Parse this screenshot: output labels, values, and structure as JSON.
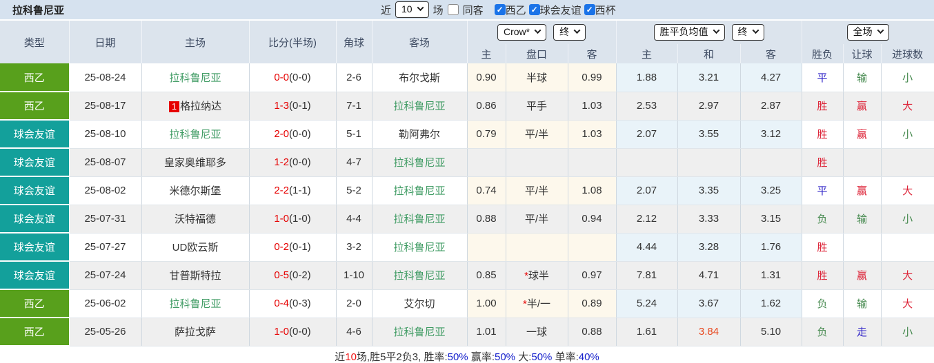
{
  "title": "拉科鲁尼亚",
  "topbar": {
    "near": "近",
    "count": "10",
    "games": "场",
    "same_opponent": "同客",
    "filters": [
      {
        "label": "西乙",
        "checked": true
      },
      {
        "label": "球会友谊",
        "checked": true
      },
      {
        "label": "西杯",
        "checked": true
      }
    ]
  },
  "header": {
    "cols": [
      "类型",
      "日期",
      "主场",
      "比分(半场)",
      "角球",
      "客场"
    ],
    "odds_provider": "Crow*",
    "odds_time": "终",
    "avg_provider": "胜平负均值",
    "avg_time": "终",
    "scope": "全场",
    "odds_cols": [
      "主",
      "盘口",
      "客"
    ],
    "avg_cols": [
      "主",
      "和",
      "客"
    ],
    "result_cols": [
      "胜负",
      "让球",
      "进球数"
    ]
  },
  "colors": {
    "badge_green": "#58a01c",
    "badge_teal": "#13a09b",
    "team_green": "#3f9b63",
    "score_red": "#e60000",
    "result_red": "#dd2438",
    "result_green": "#45894e",
    "result_blue": "#3226c8",
    "avg_orange_red": "#e8481f",
    "summary_blue": "#1722cc",
    "checkbox_blue": "#1a73e8"
  },
  "rows": [
    {
      "type": "西乙",
      "badge": "green",
      "date": "25-08-24",
      "home": {
        "name": "拉科鲁尼亚",
        "green": true,
        "rank": ""
      },
      "score": {
        "full": "0-0",
        "half": "(0-0)"
      },
      "corner": "2-6",
      "away": {
        "name": "布尔戈斯",
        "green": false
      },
      "odds": {
        "home": "0.90",
        "line": "半球",
        "star": false,
        "away": "0.99"
      },
      "avg": {
        "home": "1.88",
        "draw": "3.21",
        "away": "4.27",
        "draw_red": false
      },
      "result": [
        {
          "t": "平",
          "c": "blue"
        },
        {
          "t": "输",
          "c": "green"
        },
        {
          "t": "小",
          "c": "green"
        }
      ]
    },
    {
      "type": "西乙",
      "badge": "green",
      "date": "25-08-17",
      "home": {
        "name": "格拉纳达",
        "green": false,
        "rank": "1"
      },
      "score": {
        "full": "1-3",
        "half": "(0-1)"
      },
      "corner": "7-1",
      "away": {
        "name": "拉科鲁尼亚",
        "green": true
      },
      "odds": {
        "home": "0.86",
        "line": "平手",
        "star": false,
        "away": "1.03"
      },
      "avg": {
        "home": "2.53",
        "draw": "2.97",
        "away": "2.87",
        "draw_red": false
      },
      "result": [
        {
          "t": "胜",
          "c": "red"
        },
        {
          "t": "赢",
          "c": "red"
        },
        {
          "t": "大",
          "c": "red"
        }
      ]
    },
    {
      "type": "球会友谊",
      "badge": "teal",
      "date": "25-08-10",
      "home": {
        "name": "拉科鲁尼亚",
        "green": true,
        "rank": ""
      },
      "score": {
        "full": "2-0",
        "half": "(0-0)"
      },
      "corner": "5-1",
      "away": {
        "name": "勒阿弗尔",
        "green": false
      },
      "odds": {
        "home": "0.79",
        "line": "平/半",
        "star": false,
        "away": "1.03"
      },
      "avg": {
        "home": "2.07",
        "draw": "3.55",
        "away": "3.12",
        "draw_red": false
      },
      "result": [
        {
          "t": "胜",
          "c": "red"
        },
        {
          "t": "赢",
          "c": "red"
        },
        {
          "t": "小",
          "c": "green"
        }
      ]
    },
    {
      "type": "球会友谊",
      "badge": "teal",
      "date": "25-08-07",
      "home": {
        "name": "皇家奥维耶多",
        "green": false,
        "rank": ""
      },
      "score": {
        "full": "1-2",
        "half": "(0-0)"
      },
      "corner": "4-7",
      "away": {
        "name": "拉科鲁尼亚",
        "green": true
      },
      "odds": {
        "home": "",
        "line": "",
        "star": false,
        "away": ""
      },
      "avg": {
        "home": "",
        "draw": "",
        "away": "",
        "draw_red": false
      },
      "result": [
        {
          "t": "胜",
          "c": "red"
        },
        {
          "t": "",
          "c": "dark"
        },
        {
          "t": "",
          "c": "dark"
        }
      ]
    },
    {
      "type": "球会友谊",
      "badge": "teal",
      "date": "25-08-02",
      "home": {
        "name": "米德尔斯堡",
        "green": false,
        "rank": ""
      },
      "score": {
        "full": "2-2",
        "half": "(1-1)"
      },
      "corner": "5-2",
      "away": {
        "name": "拉科鲁尼亚",
        "green": true
      },
      "odds": {
        "home": "0.74",
        "line": "平/半",
        "star": false,
        "away": "1.08"
      },
      "avg": {
        "home": "2.07",
        "draw": "3.35",
        "away": "3.25",
        "draw_red": false
      },
      "result": [
        {
          "t": "平",
          "c": "blue"
        },
        {
          "t": "赢",
          "c": "red"
        },
        {
          "t": "大",
          "c": "red"
        }
      ]
    },
    {
      "type": "球会友谊",
      "badge": "teal",
      "date": "25-07-31",
      "home": {
        "name": "沃特福德",
        "green": false,
        "rank": ""
      },
      "score": {
        "full": "1-0",
        "half": "(1-0)"
      },
      "corner": "4-4",
      "away": {
        "name": "拉科鲁尼亚",
        "green": true
      },
      "odds": {
        "home": "0.88",
        "line": "平/半",
        "star": false,
        "away": "0.94"
      },
      "avg": {
        "home": "2.12",
        "draw": "3.33",
        "away": "3.15",
        "draw_red": false
      },
      "result": [
        {
          "t": "负",
          "c": "green"
        },
        {
          "t": "输",
          "c": "green"
        },
        {
          "t": "小",
          "c": "green"
        }
      ]
    },
    {
      "type": "球会友谊",
      "badge": "teal",
      "date": "25-07-27",
      "home": {
        "name": "UD欧云斯",
        "green": false,
        "rank": ""
      },
      "score": {
        "full": "0-2",
        "half": "(0-1)"
      },
      "corner": "3-2",
      "away": {
        "name": "拉科鲁尼亚",
        "green": true
      },
      "odds": {
        "home": "",
        "line": "",
        "star": false,
        "away": ""
      },
      "avg": {
        "home": "4.44",
        "draw": "3.28",
        "away": "1.76",
        "draw_red": false
      },
      "result": [
        {
          "t": "胜",
          "c": "red"
        },
        {
          "t": "",
          "c": "dark"
        },
        {
          "t": "",
          "c": "dark"
        }
      ]
    },
    {
      "type": "球会友谊",
      "badge": "teal",
      "date": "25-07-24",
      "home": {
        "name": "甘普斯特拉",
        "green": false,
        "rank": ""
      },
      "score": {
        "full": "0-5",
        "half": "(0-2)"
      },
      "corner": "1-10",
      "away": {
        "name": "拉科鲁尼亚",
        "green": true
      },
      "odds": {
        "home": "0.85",
        "line": "球半",
        "star": true,
        "away": "0.97"
      },
      "avg": {
        "home": "7.81",
        "draw": "4.71",
        "away": "1.31",
        "draw_red": false
      },
      "result": [
        {
          "t": "胜",
          "c": "red"
        },
        {
          "t": "赢",
          "c": "red"
        },
        {
          "t": "大",
          "c": "red"
        }
      ]
    },
    {
      "type": "西乙",
      "badge": "green",
      "date": "25-06-02",
      "home": {
        "name": "拉科鲁尼亚",
        "green": true,
        "rank": ""
      },
      "score": {
        "full": "0-4",
        "half": "(0-3)"
      },
      "corner": "2-0",
      "away": {
        "name": "艾尔切",
        "green": false
      },
      "odds": {
        "home": "1.00",
        "line": "半/一",
        "star": true,
        "away": "0.89"
      },
      "avg": {
        "home": "5.24",
        "draw": "3.67",
        "away": "1.62",
        "draw_red": false
      },
      "result": [
        {
          "t": "负",
          "c": "green"
        },
        {
          "t": "输",
          "c": "green"
        },
        {
          "t": "大",
          "c": "red"
        }
      ]
    },
    {
      "type": "西乙",
      "badge": "green",
      "date": "25-05-26",
      "home": {
        "name": "萨拉戈萨",
        "green": false,
        "rank": ""
      },
      "score": {
        "full": "1-0",
        "half": "(0-0)"
      },
      "corner": "4-6",
      "away": {
        "name": "拉科鲁尼亚",
        "green": true
      },
      "odds": {
        "home": "1.01",
        "line": "一球",
        "star": false,
        "away": "0.88"
      },
      "avg": {
        "home": "1.61",
        "draw": "3.84",
        "away": "5.10",
        "draw_red": true
      },
      "result": [
        {
          "t": "负",
          "c": "green"
        },
        {
          "t": "走",
          "c": "blue"
        },
        {
          "t": "小",
          "c": "green"
        }
      ]
    }
  ],
  "summary": {
    "segments": [
      {
        "t": "近",
        "c": "dark"
      },
      {
        "t": "10",
        "c": "red2"
      },
      {
        "t": "场,胜5平2负3, 胜率:",
        "c": "dark"
      },
      {
        "t": "50%",
        "c": "blue2"
      },
      {
        "t": " 赢率:",
        "c": "dark"
      },
      {
        "t": "50%",
        "c": "blue2"
      },
      {
        "t": " 大:",
        "c": "dark"
      },
      {
        "t": "50%",
        "c": "blue2"
      },
      {
        "t": " 单率:",
        "c": "dark"
      },
      {
        "t": "40%",
        "c": "blue2"
      }
    ]
  }
}
